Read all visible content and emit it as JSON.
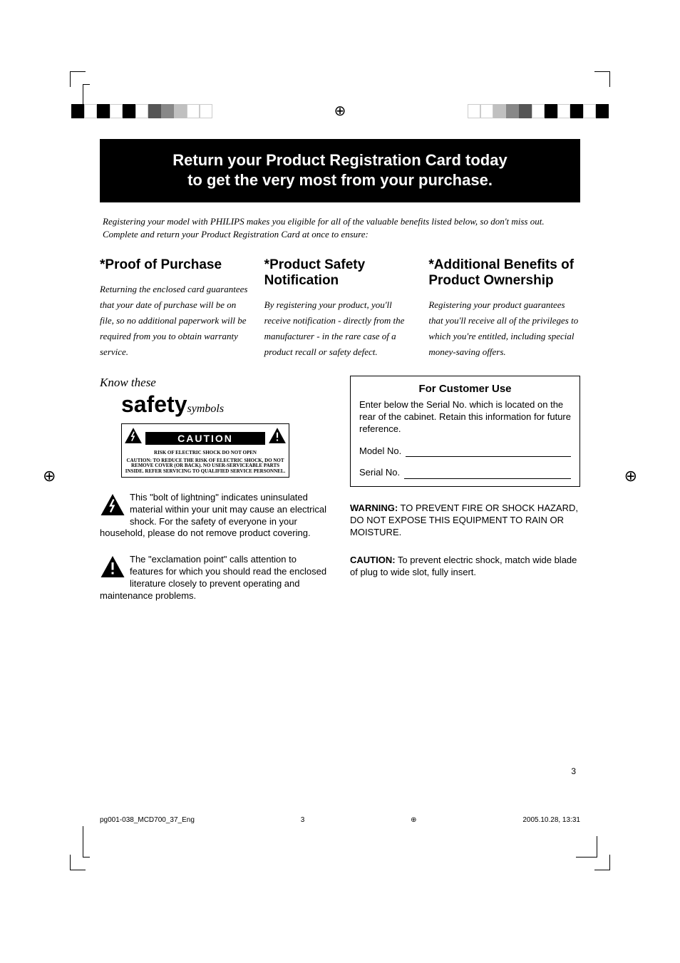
{
  "banner": {
    "line1": "Return your Product Registration Card today",
    "line2": "to get the very most from your purchase."
  },
  "intro": "Registering your model with PHILIPS makes you eligible for all of the valuable benefits listed below, so don't miss out. Complete and return your Product Registration Card at once to ensure:",
  "columns": {
    "col1": {
      "heading": "*Proof of Purchase",
      "body": "Returning the enclosed card guarantees that your date of purchase will be on file, so no additional paperwork will be required from you to obtain warranty service."
    },
    "col2": {
      "heading": "*Product Safety Notification",
      "body": "By registering your product, you'll receive notification - directly from the manufacturer - in the rare case of a product recall or safety defect."
    },
    "col3": {
      "heading": "*Additional Benefits of Product Ownership",
      "body": "Registering your product guarantees that you'll receive all of the privileges to which you're entitled, including special money-saving offers."
    }
  },
  "safety": {
    "know_these": "Know these",
    "safety_word": "safety",
    "symbols_word": "symbols",
    "caution_title": "CAUTION",
    "caution_risk": "RISK OF ELECTRIC SHOCK DO NOT OPEN",
    "caution_fine": "CAUTION: TO REDUCE THE RISK OF ELECTRIC SHOCK, DO NOT REMOVE COVER (OR BACK). NO USER-SERVICEABLE PARTS INSIDE. REFER SERVICING TO QUALIFIED SERVICE PERSONNEL.",
    "bolt_para": "This \"bolt of lightning\" indicates uninsulated material within your unit may cause an electrical shock. For the safety of everyone in your household, please do not remove product covering.",
    "excl_para": "The \"exclamation point\" calls attention to features for which you should read the enclosed literature closely to prevent operating and maintenance problems."
  },
  "customer_use": {
    "heading": "For Customer Use",
    "body": "Enter below the Serial No. which is located on the rear of the cabinet. Retain this information for future reference.",
    "model_label": "Model No.",
    "serial_label": "Serial No."
  },
  "warning": {
    "label": "WARNING:",
    "body": " TO PREVENT FIRE OR SHOCK HAZARD, DO NOT EXPOSE THIS EQUIPMENT TO RAIN OR MOISTURE."
  },
  "caution_plug": {
    "label": "CAUTION:",
    "body": " To prevent electric shock, match wide blade of plug to wide slot, fully insert."
  },
  "page_number": "3",
  "footer": {
    "file": "pg001-038_MCD700_37_Eng",
    "pg": "3",
    "date": "2005.10.28, 13:31"
  },
  "icons": {
    "bolt_triangle": "⚡",
    "excl_triangle": "!"
  }
}
